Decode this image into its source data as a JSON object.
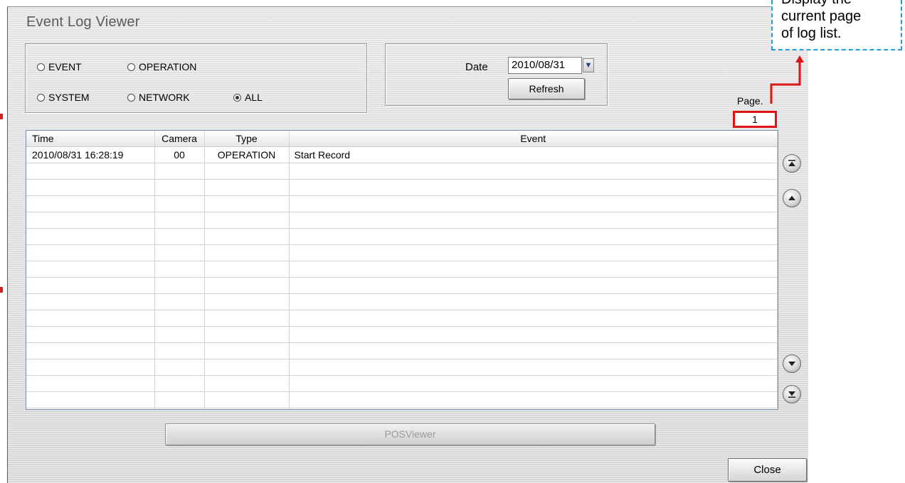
{
  "window": {
    "title": "Event Log Viewer"
  },
  "filters": {
    "options": [
      {
        "label": "EVENT",
        "checked": false
      },
      {
        "label": "OPERATION",
        "checked": false
      },
      {
        "label": "SYSTEM",
        "checked": false
      },
      {
        "label": "NETWORK",
        "checked": false
      },
      {
        "label": "ALL",
        "checked": true
      }
    ]
  },
  "date_panel": {
    "label": "Date",
    "value": "2010/08/31",
    "refresh_label": "Refresh"
  },
  "page": {
    "label": "Page.",
    "value": "1"
  },
  "log_table": {
    "columns": [
      "Time",
      "Camera",
      "Type",
      "Event"
    ],
    "rows": [
      {
        "time": "2010/08/31 16:28:19",
        "camera": "00",
        "type": "OPERATION",
        "event": "Start Record"
      }
    ],
    "empty_rows": 15
  },
  "navigation": [
    "first-page-icon",
    "previous-page-icon",
    "next-page-icon",
    "last-page-icon"
  ],
  "buttons": {
    "pos_viewer": "POSViewer",
    "close": "Close"
  },
  "callout": {
    "line1": "Display the",
    "line2": "current page",
    "line3": "of log list."
  },
  "colors": {
    "highlight": "#e01414",
    "callout_border": "#1e9fd8"
  }
}
